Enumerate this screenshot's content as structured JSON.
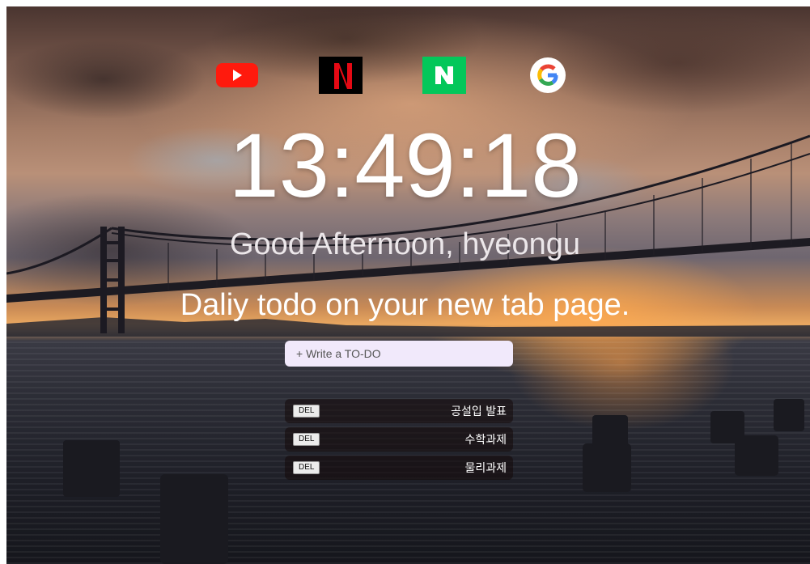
{
  "quick_links": [
    {
      "name": "YouTube",
      "icon": "youtube-icon",
      "color": "#ff0000"
    },
    {
      "name": "Netflix",
      "icon": "netflix-icon",
      "glyph": "N",
      "color": "#e50914"
    },
    {
      "name": "Naver",
      "icon": "naver-icon",
      "glyph": "N",
      "color": "#03c75a"
    },
    {
      "name": "Google",
      "icon": "google-icon",
      "glyph": "G",
      "color": "#4285f4"
    }
  ],
  "clock": {
    "time": "13:49:18"
  },
  "greeting": {
    "text": "Good Afternoon, hyeongu"
  },
  "headline": {
    "text": "Daliy todo on your new tab page."
  },
  "todo": {
    "input_placeholder": "+ Write a TO-DO",
    "delete_label": "DEL",
    "items": [
      "공설입 발표",
      "수학과제",
      "물리과제"
    ]
  }
}
